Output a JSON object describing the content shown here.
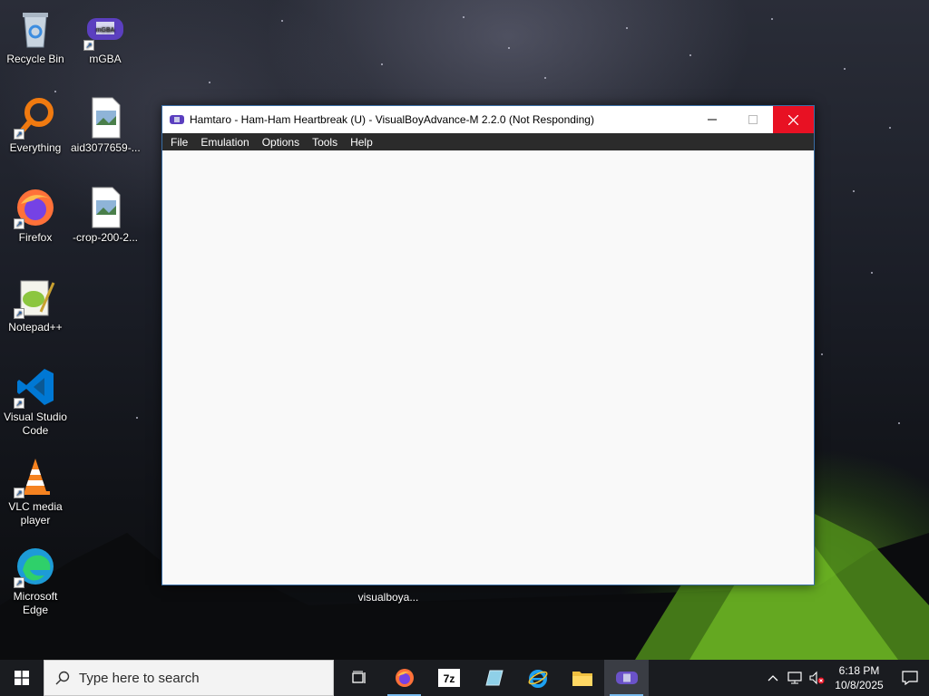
{
  "desktop": {
    "icons": [
      {
        "label": "Recycle Bin",
        "icon": "recycle-bin-icon"
      },
      {
        "label": "mGBA",
        "icon": "mgba-icon"
      },
      {
        "label": "Everything",
        "icon": "everything-search-icon"
      },
      {
        "label": "aid3077659-...",
        "icon": "image-file-icon"
      },
      {
        "label": "Firefox",
        "icon": "firefox-icon"
      },
      {
        "label": "-crop-200-2...",
        "icon": "image-file-icon"
      },
      {
        "label": "Notepad++",
        "icon": "notepadpp-icon"
      },
      {
        "label": "Visual Studio Code",
        "icon": "vscode-icon"
      },
      {
        "label": "VLC media player",
        "icon": "vlc-icon"
      },
      {
        "label": "Microsoft Edge",
        "icon": "edge-icon"
      }
    ],
    "vba_label": "visualboya..."
  },
  "window": {
    "title": "Hamtaro - Ham-Ham Heartbreak (U) - VisualBoyAdvance-M 2.2.0 (Not Responding)",
    "menu": [
      "File",
      "Emulation",
      "Options",
      "Tools",
      "Help"
    ]
  },
  "taskbar": {
    "search_placeholder": "Type here to search",
    "apps": [
      "task-view-icon",
      "firefox-icon",
      "7zip-icon",
      "app-icon",
      "ie-icon",
      "file-explorer-icon",
      "visualboyadvance-icon"
    ],
    "time": "6:18 PM",
    "date": "10/8/2025"
  },
  "colors": {
    "close_button": "#e81123",
    "taskbar": "#1a1c20",
    "tent_glow": "#78c828"
  }
}
